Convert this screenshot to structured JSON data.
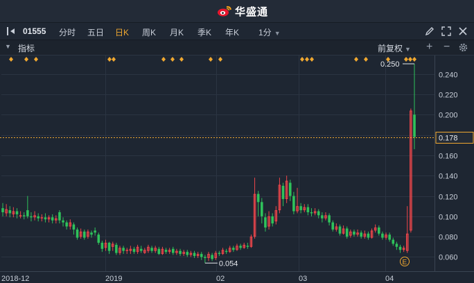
{
  "app": {
    "name": "华盛通"
  },
  "toolbar": {
    "symbol": "01555",
    "periods": [
      "分时",
      "五日",
      "日K",
      "周K",
      "月K",
      "季K",
      "年K"
    ],
    "active_period": "日K",
    "minute_selector": "1分"
  },
  "indicator_bar": {
    "label": "指标",
    "adjust": "前复权"
  },
  "colors": {
    "up": "#f0464b",
    "down": "#2fc25b",
    "accent": "#f0a830",
    "background": "#1e2632"
  },
  "icons": {
    "collapse": "panel-collapse-icon",
    "draw": "pencil-icon",
    "fullscreen": "expand-icon",
    "close": "close-icon",
    "add": "plus-icon",
    "remove": "minus-icon",
    "settings": "gear-icon"
  },
  "chart_data": {
    "type": "candlestick",
    "y_ticks": [
      "0.240",
      "0.220",
      "0.200",
      "0.180",
      "0.160",
      "0.140",
      "0.120",
      "0.100",
      "0.080",
      "0.060"
    ],
    "ylim": [
      0.046,
      0.25
    ],
    "x_ticks": [
      "2018-12",
      "2019",
      "02",
      "03",
      "04"
    ],
    "current_price": "0.178",
    "max_marker": "0.250",
    "min_marker": "0.054",
    "event_marker": "E",
    "grid": true,
    "candles": [
      [
        0.108,
        0.104,
        0.113,
        0.1
      ],
      [
        0.103,
        0.107,
        0.112,
        0.1
      ],
      [
        0.106,
        0.103,
        0.11,
        0.099
      ],
      [
        0.102,
        0.105,
        0.109,
        0.099
      ],
      [
        0.105,
        0.102,
        0.108,
        0.098
      ],
      [
        0.101,
        0.101,
        0.105,
        0.098
      ],
      [
        0.101,
        0.1,
        0.104,
        0.097
      ],
      [
        0.106,
        0.1,
        0.12,
        0.098
      ],
      [
        0.1,
        0.099,
        0.104,
        0.095
      ],
      [
        0.099,
        0.101,
        0.105,
        0.096
      ],
      [
        0.1,
        0.098,
        0.103,
        0.095
      ],
      [
        0.098,
        0.099,
        0.102,
        0.095
      ],
      [
        0.099,
        0.097,
        0.103,
        0.094
      ],
      [
        0.097,
        0.099,
        0.101,
        0.094
      ],
      [
        0.099,
        0.096,
        0.102,
        0.093
      ],
      [
        0.096,
        0.098,
        0.101,
        0.093
      ],
      [
        0.104,
        0.096,
        0.106,
        0.093
      ],
      [
        0.096,
        0.094,
        0.099,
        0.09
      ],
      [
        0.094,
        0.09,
        0.096,
        0.087
      ],
      [
        0.09,
        0.094,
        0.097,
        0.087
      ],
      [
        0.092,
        0.087,
        0.094,
        0.082
      ],
      [
        0.087,
        0.079,
        0.089,
        0.077
      ],
      [
        0.08,
        0.085,
        0.088,
        0.078
      ],
      [
        0.085,
        0.079,
        0.087,
        0.077
      ],
      [
        0.08,
        0.085,
        0.087,
        0.078
      ],
      [
        0.084,
        0.082,
        0.086,
        0.079
      ],
      [
        0.086,
        0.084,
        0.089,
        0.081
      ],
      [
        0.082,
        0.074,
        0.084,
        0.072
      ],
      [
        0.074,
        0.068,
        0.076,
        0.065
      ],
      [
        0.069,
        0.074,
        0.077,
        0.066
      ],
      [
        0.074,
        0.066,
        0.075,
        0.063
      ],
      [
        0.07,
        0.073,
        0.075,
        0.066
      ],
      [
        0.072,
        0.064,
        0.074,
        0.062
      ],
      [
        0.064,
        0.069,
        0.071,
        0.062
      ],
      [
        0.069,
        0.066,
        0.071,
        0.063
      ],
      [
        0.066,
        0.067,
        0.069,
        0.063
      ],
      [
        0.066,
        0.068,
        0.071,
        0.063
      ],
      [
        0.068,
        0.065,
        0.07,
        0.063
      ],
      [
        0.065,
        0.07,
        0.072,
        0.063
      ],
      [
        0.068,
        0.066,
        0.071,
        0.064
      ],
      [
        0.064,
        0.067,
        0.069,
        0.063
      ],
      [
        0.066,
        0.07,
        0.072,
        0.064
      ],
      [
        0.069,
        0.066,
        0.071,
        0.064
      ],
      [
        0.066,
        0.069,
        0.071,
        0.064
      ],
      [
        0.068,
        0.063,
        0.07,
        0.062
      ],
      [
        0.063,
        0.068,
        0.07,
        0.062
      ],
      [
        0.067,
        0.065,
        0.069,
        0.063
      ],
      [
        0.065,
        0.067,
        0.069,
        0.063
      ],
      [
        0.068,
        0.064,
        0.07,
        0.062
      ],
      [
        0.064,
        0.066,
        0.068,
        0.062
      ],
      [
        0.066,
        0.063,
        0.068,
        0.061
      ],
      [
        0.063,
        0.065,
        0.067,
        0.061
      ],
      [
        0.065,
        0.062,
        0.067,
        0.06
      ],
      [
        0.062,
        0.064,
        0.066,
        0.06
      ],
      [
        0.064,
        0.061,
        0.066,
        0.059
      ],
      [
        0.061,
        0.063,
        0.065,
        0.059
      ],
      [
        0.063,
        0.06,
        0.065,
        0.057
      ],
      [
        0.06,
        0.059,
        0.062,
        0.054
      ],
      [
        0.059,
        0.063,
        0.065,
        0.056
      ],
      [
        0.062,
        0.058,
        0.064,
        0.056
      ],
      [
        0.059,
        0.064,
        0.066,
        0.057
      ],
      [
        0.064,
        0.063,
        0.066,
        0.061
      ],
      [
        0.063,
        0.067,
        0.069,
        0.062
      ],
      [
        0.066,
        0.065,
        0.068,
        0.063
      ],
      [
        0.065,
        0.069,
        0.071,
        0.064
      ],
      [
        0.069,
        0.067,
        0.071,
        0.065
      ],
      [
        0.067,
        0.071,
        0.073,
        0.066
      ],
      [
        0.071,
        0.069,
        0.073,
        0.067
      ],
      [
        0.069,
        0.072,
        0.074,
        0.068
      ],
      [
        0.071,
        0.07,
        0.074,
        0.068
      ],
      [
        0.07,
        0.08,
        0.082,
        0.069
      ],
      [
        0.08,
        0.122,
        0.138,
        0.078
      ],
      [
        0.122,
        0.114,
        0.125,
        0.1
      ],
      [
        0.114,
        0.1,
        0.118,
        0.093
      ],
      [
        0.099,
        0.089,
        0.103,
        0.085
      ],
      [
        0.09,
        0.1,
        0.105,
        0.087
      ],
      [
        0.1,
        0.093,
        0.103,
        0.09
      ],
      [
        0.095,
        0.106,
        0.11,
        0.092
      ],
      [
        0.106,
        0.131,
        0.138,
        0.103
      ],
      [
        0.13,
        0.117,
        0.133,
        0.11
      ],
      [
        0.117,
        0.135,
        0.14,
        0.113
      ],
      [
        0.133,
        0.12,
        0.136,
        0.115
      ],
      [
        0.12,
        0.105,
        0.124,
        0.102
      ],
      [
        0.105,
        0.11,
        0.128,
        0.103
      ],
      [
        0.11,
        0.106,
        0.113,
        0.103
      ],
      [
        0.106,
        0.109,
        0.112,
        0.104
      ],
      [
        0.109,
        0.104,
        0.112,
        0.101
      ],
      [
        0.104,
        0.103,
        0.108,
        0.1
      ],
      [
        0.103,
        0.105,
        0.108,
        0.101
      ],
      [
        0.105,
        0.101,
        0.107,
        0.098
      ],
      [
        0.101,
        0.098,
        0.104,
        0.094
      ],
      [
        0.098,
        0.101,
        0.104,
        0.096
      ],
      [
        0.101,
        0.094,
        0.103,
        0.091
      ],
      [
        0.094,
        0.087,
        0.096,
        0.085
      ],
      [
        0.087,
        0.09,
        0.093,
        0.085
      ],
      [
        0.09,
        0.083,
        0.092,
        0.081
      ],
      [
        0.083,
        0.088,
        0.091,
        0.082
      ],
      [
        0.088,
        0.08,
        0.09,
        0.078
      ],
      [
        0.081,
        0.085,
        0.087,
        0.079
      ],
      [
        0.085,
        0.082,
        0.087,
        0.08
      ],
      [
        0.082,
        0.084,
        0.087,
        0.08
      ],
      [
        0.084,
        0.08,
        0.086,
        0.078
      ],
      [
        0.08,
        0.083,
        0.086,
        0.078
      ],
      [
        0.083,
        0.079,
        0.085,
        0.077
      ],
      [
        0.079,
        0.086,
        0.088,
        0.078
      ],
      [
        0.086,
        0.089,
        0.092,
        0.084
      ],
      [
        0.089,
        0.083,
        0.091,
        0.081
      ],
      [
        0.083,
        0.079,
        0.085,
        0.077
      ],
      [
        0.079,
        0.082,
        0.084,
        0.077
      ],
      [
        0.082,
        0.077,
        0.084,
        0.075
      ],
      [
        0.077,
        0.073,
        0.079,
        0.071
      ],
      [
        0.073,
        0.07,
        0.075,
        0.067
      ],
      [
        0.07,
        0.067,
        0.072,
        0.064
      ],
      [
        0.067,
        0.069,
        0.071,
        0.065
      ],
      [
        0.066,
        0.083,
        0.11,
        0.064
      ],
      [
        0.086,
        0.204,
        0.206,
        0.084
      ],
      [
        0.2,
        0.178,
        0.25,
        0.166
      ]
    ]
  }
}
